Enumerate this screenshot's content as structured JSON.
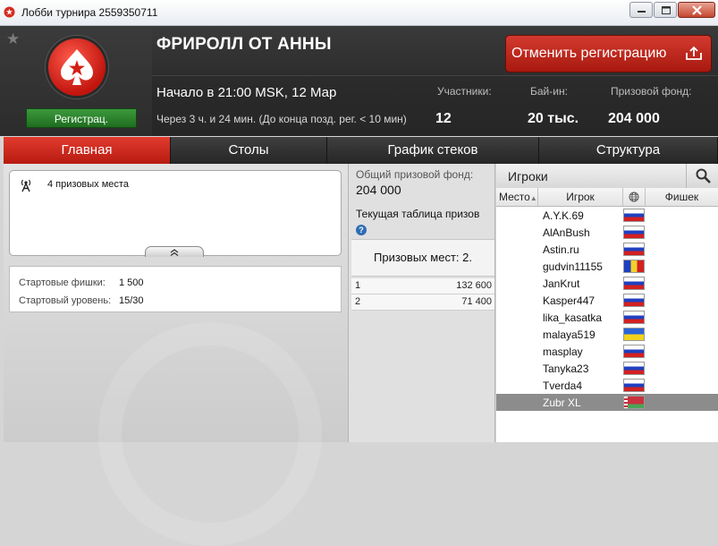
{
  "window": {
    "title": "Лобби турнира 2559350711",
    "app_icon": "pokerstars-logo",
    "controls": [
      "minimize-icon",
      "maximize-icon",
      "close-icon"
    ]
  },
  "header": {
    "tournament_name": "ФРИРОЛЛ ОТ АННЫ",
    "status_ribbon": "Регистрац.",
    "cancel_button": "Отменить регистрацию",
    "start_time": "Начало в 21:00 MSK, 12 Мар",
    "countdown": "Через 3 ч. и 24 мин. (До конца позд. рег. < 10 мин)",
    "stats": {
      "entrants_label": "Участники:",
      "entrants_value": "12",
      "buyin_label": "Бай-ин:",
      "buyin_value": "20 тыс.",
      "prize_label": "Призовой фонд:",
      "prize_value": "204 000"
    }
  },
  "tabs": [
    {
      "label": "Главная",
      "active": true
    },
    {
      "label": "Столы",
      "active": false
    },
    {
      "label": "График стеков",
      "active": false
    },
    {
      "label": "Структура",
      "active": false
    }
  ],
  "info": {
    "prize_places": "4 призовых места",
    "starting_chips_label": "Стартовые фишки:",
    "starting_chips_value": "1 500",
    "starting_level_label": "Стартовый уровень:",
    "starting_level_value": "15/30"
  },
  "prizes": {
    "pool_label": "Общий призовой фонд:",
    "pool_value": "204 000",
    "table_label": "Текущая таблица призов",
    "places_text": "Призовых мест: 2.",
    "payouts": [
      {
        "place": "1",
        "amount": "132 600"
      },
      {
        "place": "2",
        "amount": "71 400"
      }
    ]
  },
  "players": {
    "title": "Игроки",
    "columns": {
      "rank": "Место",
      "player": "Игрок",
      "country": "globe-icon",
      "chips": "Фишек"
    },
    "rows": [
      {
        "name": "A.Y.K.69",
        "flag": "ru",
        "selected": false
      },
      {
        "name": "AlAnBush",
        "flag": "ru",
        "selected": false
      },
      {
        "name": "Astin.ru",
        "flag": "ru",
        "selected": false
      },
      {
        "name": "gudvin11155",
        "flag": "md",
        "selected": false
      },
      {
        "name": "JanKrut",
        "flag": "ru",
        "selected": false
      },
      {
        "name": "Kasper447",
        "flag": "ru",
        "selected": false
      },
      {
        "name": "lika_kasatka",
        "flag": "ru",
        "selected": false
      },
      {
        "name": "malaya519",
        "flag": "ua",
        "selected": false
      },
      {
        "name": "masplay",
        "flag": "ru",
        "selected": false
      },
      {
        "name": "Tanyka23",
        "flag": "ru",
        "selected": false
      },
      {
        "name": "Tverda4",
        "flag": "ru",
        "selected": false
      },
      {
        "name": "Zubr XL",
        "flag": "by",
        "selected": true
      }
    ]
  },
  "colors": {
    "accent_red": "#c8231a",
    "ribbon_green": "#2a7f2b",
    "header_dark": "#2c2c2c"
  }
}
